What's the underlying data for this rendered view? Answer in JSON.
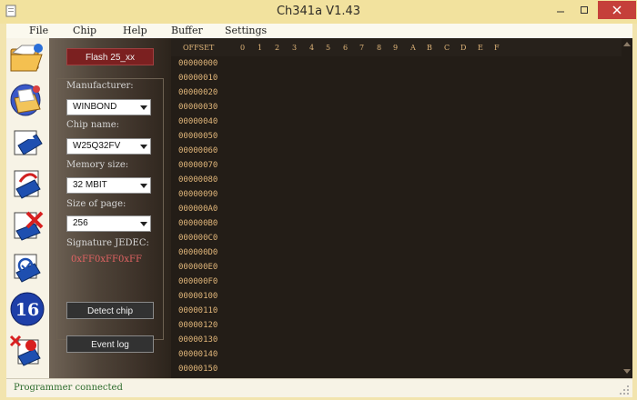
{
  "window": {
    "title": "Ch341a V1.43"
  },
  "menu": [
    "File",
    "Chip",
    "Help",
    "Buffer",
    "Settings"
  ],
  "toolbar": {
    "buttons": [
      {
        "icon": "open-folder-icon"
      },
      {
        "icon": "save-folder-icon"
      },
      {
        "icon": "read-chip-icon"
      },
      {
        "icon": "write-chip-icon"
      },
      {
        "icon": "erase-chip-icon"
      },
      {
        "icon": "verify-chip-icon"
      },
      {
        "icon": "hex-16-icon"
      },
      {
        "icon": "auto-program-icon"
      }
    ]
  },
  "panel": {
    "flash_label": "Flash 25_xx",
    "manufacturer_label": "Manufacturer:",
    "manufacturer_value": "WINBOND",
    "chip_name_label": "Chip name:",
    "chip_name_value": "W25Q32FV",
    "memory_size_label": "Memory size:",
    "memory_size_value": "32 MBIT",
    "page_size_label": "Size of page:",
    "page_size_value": "256",
    "signature_label": "Signature JEDEC:",
    "signature_values": [
      "0xFF",
      "0xFF",
      "0xFF"
    ],
    "detect_label": "Detect chip",
    "log_label": "Event log"
  },
  "hex": {
    "offset_header": "OFFSET",
    "columns": [
      "0",
      "1",
      "2",
      "3",
      "4",
      "5",
      "6",
      "7",
      "8",
      "9",
      "A",
      "B",
      "C",
      "D",
      "E",
      "F"
    ],
    "rows": [
      "00000000",
      "00000010",
      "00000020",
      "00000030",
      "00000040",
      "00000050",
      "00000060",
      "00000070",
      "00000080",
      "00000090",
      "000000A0",
      "000000B0",
      "000000C0",
      "000000D0",
      "000000E0",
      "000000F0",
      "00000100",
      "00000110",
      "00000120",
      "00000130",
      "00000140",
      "00000150"
    ]
  },
  "status": {
    "text": "Programmer connected"
  },
  "colors": {
    "title_bar": "#f2e29e",
    "close_button": "#c5403a",
    "hex_text": "#e1b67a",
    "signature": "#e26363",
    "status_text": "#2c6b2c"
  }
}
